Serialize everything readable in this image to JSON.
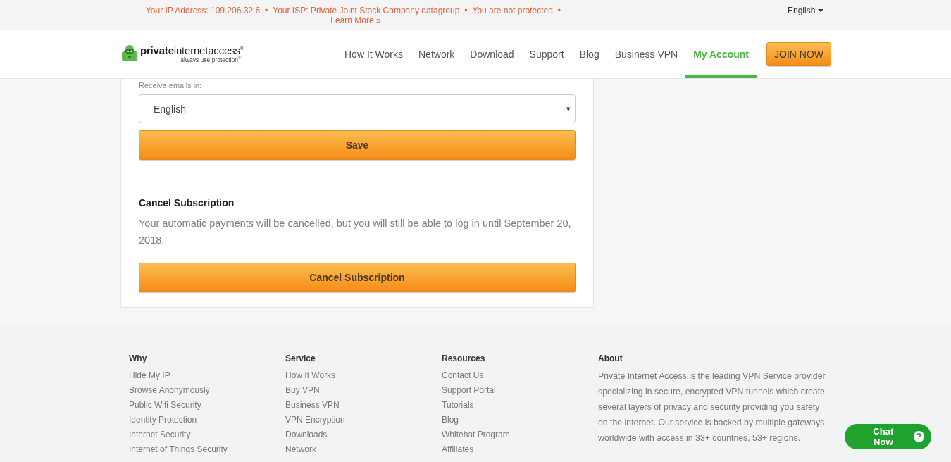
{
  "top_bar": {
    "notices": [
      {
        "text": "Your IP Address: 109.206.32.6",
        "separator": "•"
      },
      {
        "text": "Your ISP: Private Joint Stock Company datagroup",
        "separator": "•"
      },
      {
        "text": "You are not protected",
        "separator": "•"
      }
    ],
    "learn_more": "Learn More »",
    "language": "English"
  },
  "header": {
    "logo": {
      "name": "**private**internetaccess$^{®}$",
      "tagline": "always use protection$^{®}$"
    },
    "nav": [
      {
        "label": "How It Works",
        "selected": false
      },
      {
        "label": "Network",
        "selected": false
      },
      {
        "label": "Download",
        "selected": false
      },
      {
        "label": "Support",
        "selected": false
      },
      {
        "label": "Blog",
        "selected": false
      },
      {
        "label": "Business VPN",
        "selected": false
      },
      {
        "label": "My Account",
        "selected": true
      }
    ],
    "join_button": "JOIN NOW"
  },
  "email_settings": {
    "label": "Receive emails in:",
    "value": "English",
    "arrow": "▾",
    "save_button": "Save"
  },
  "cancel_section": {
    "title": "Cancel Subscription",
    "text": "Your automatic payments will be cancelled, but you will still be able to log in until September 20, 2018.",
    "button": "Cancel Subscription"
  },
  "footer": {
    "columns": [
      {
        "title": "Why",
        "links": [
          "Hide My IP",
          "Browse Anonymously",
          "Public Wifi Security",
          "Identity Protection",
          "Internet Security",
          "Internet of Things Security"
        ]
      },
      {
        "title": "Service",
        "links": [
          "How It Works",
          "Buy VPN",
          "Business VPN",
          "VPN Encryption",
          "Downloads",
          "Network"
        ]
      },
      {
        "title": "Resources",
        "links": [
          "Contact Us",
          "Support Portal",
          "Tutorials",
          "Blog",
          "Whitehat Program",
          "Affiliates"
        ]
      }
    ],
    "about": {
      "title": "About",
      "text": "Private Internet Access is the leading VPN Service provider specializing in secure, encrypted VPN tunnels which create several layers of privacy and security providing you safety on the internet. Our service is backed by multiple gateways worldwide with access in 33+ countries, 53+ regions."
    }
  },
  "chat_button": {
    "label": "Chat Now",
    "help": "?"
  }
}
